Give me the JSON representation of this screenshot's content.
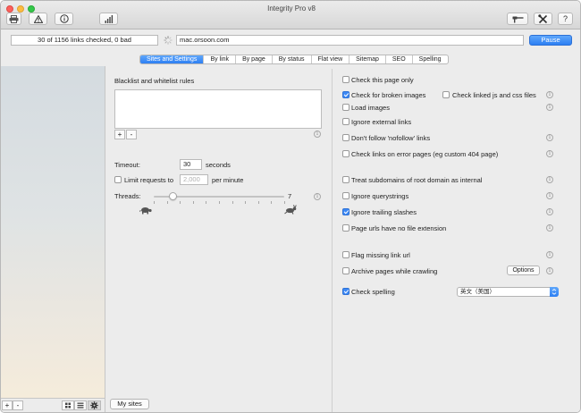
{
  "window": {
    "title": "Integrity Pro v8"
  },
  "toolbar": {
    "icons": [
      "printer-icon",
      "warning-icon",
      "info-icon",
      "bar-chart-icon",
      "hammer-icon",
      "tools-icon",
      "help-icon"
    ],
    "help_label": "?"
  },
  "address_bar": {
    "status": "30 of 1156 links checked, 0 bad",
    "url": "mac.orsoon.com",
    "pause_label": "Pause"
  },
  "tabs": [
    "Sites and Settings",
    "By link",
    "By page",
    "By status",
    "Flat view",
    "Sitemap",
    "SEO",
    "Spelling"
  ],
  "active_tab": "Sites and Settings",
  "left_settings": {
    "rules_label": "Blacklist and whitelist rules",
    "add_label": "+",
    "remove_label": "-",
    "timeout_label": "Timeout:",
    "timeout_value": "30",
    "timeout_unit": "seconds",
    "limit_label": "Limit requests to",
    "limit_checked": false,
    "limit_placeholder": "2,000",
    "limit_unit": "per minute",
    "threads_label": "Threads:",
    "threads_value": "7",
    "threads_max": 10,
    "threads_level": 0.15
  },
  "right_settings": {
    "check_this_page_only": {
      "label": "Check this page only",
      "checked": false
    },
    "check_broken_images": {
      "label": "Check for broken images",
      "checked": true
    },
    "check_linked_js_css": {
      "label": "Check linked js and css files",
      "checked": false
    },
    "load_images": {
      "label": "Load images",
      "checked": false
    },
    "ignore_external": {
      "label": "Ignore external links",
      "checked": false
    },
    "dont_follow_nofollow": {
      "label": "Don't follow 'nofollow' links",
      "checked": false
    },
    "check_error_pages": {
      "label": "Check links on error pages (eg custom 404 page)",
      "checked": false
    },
    "treat_subdomains": {
      "label": "Treat subdomains of root domain as internal",
      "checked": false
    },
    "ignore_querystrings": {
      "label": "Ignore querystrings",
      "checked": false
    },
    "ignore_trailing_slashes": {
      "label": "Ignore trailing slashes",
      "checked": true
    },
    "no_file_extension": {
      "label": "Page urls have no file extension",
      "checked": false
    },
    "flag_missing_link_url": {
      "label": "Flag missing link url",
      "checked": false
    },
    "archive_pages": {
      "label": "Archive pages while crawling",
      "checked": false
    },
    "options_label": "Options",
    "check_spelling": {
      "label": "Check spelling",
      "checked": true
    },
    "spelling_language": "英文（美国）"
  },
  "sidebar_footer": {
    "add_label": "+",
    "remove_label": "-",
    "my_sites_label": "My sites"
  },
  "colors": {
    "accent": "#3d89f5",
    "pause": "#2d7ff3"
  }
}
